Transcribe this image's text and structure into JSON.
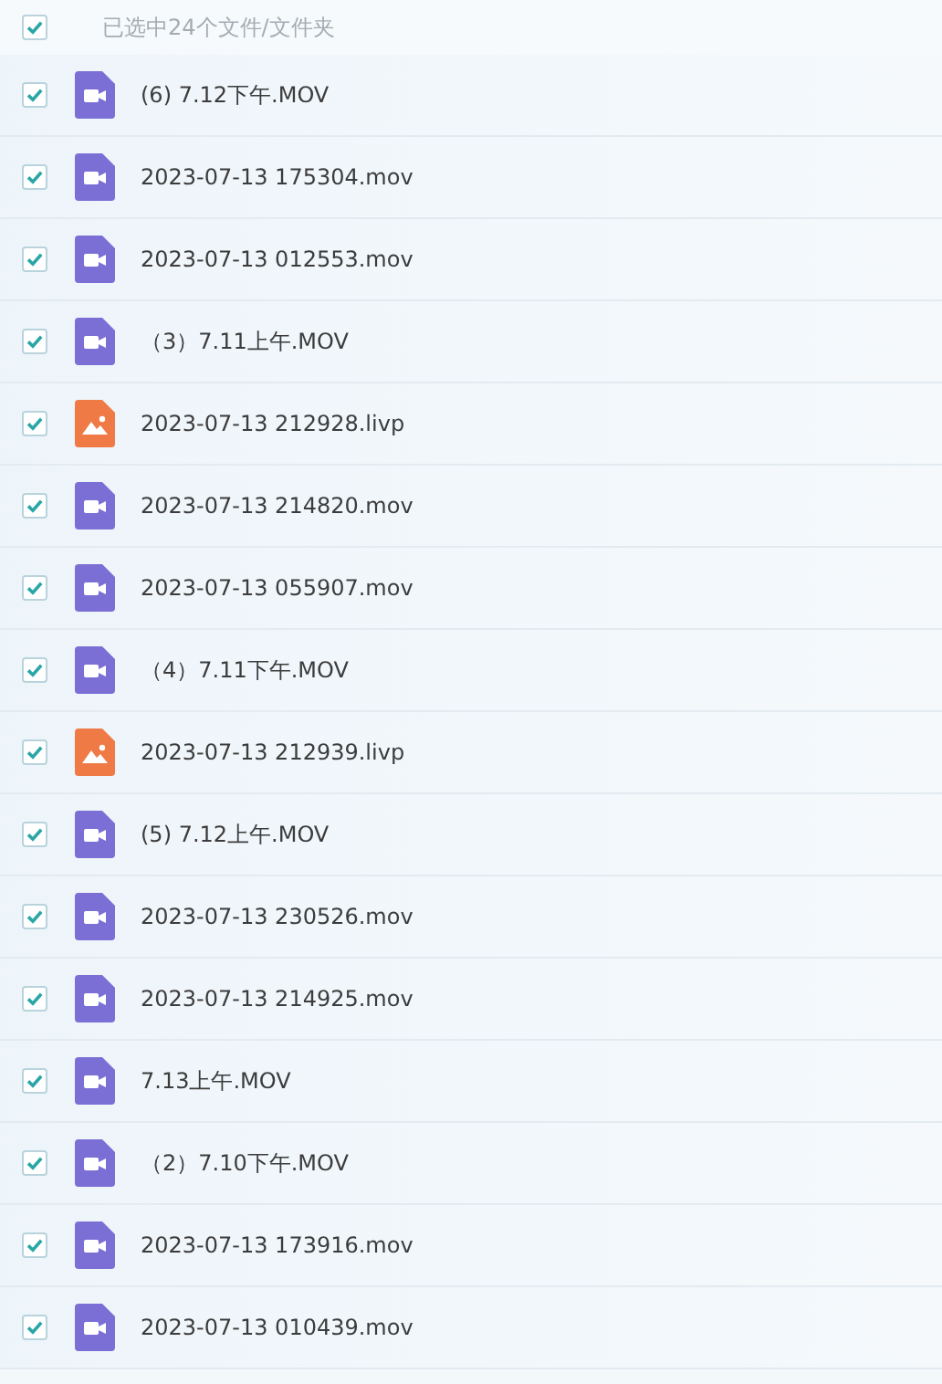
{
  "header": {
    "checked": true,
    "label": "已选中24个文件/文件夹"
  },
  "files": [
    {
      "name": "(6) 7.12下午.MOV",
      "kind": "video",
      "checked": true
    },
    {
      "name": "2023-07-13 175304.mov",
      "kind": "video",
      "checked": true
    },
    {
      "name": "2023-07-13 012553.mov",
      "kind": "video",
      "checked": true
    },
    {
      "name": "（3）7.11上午.MOV",
      "kind": "video",
      "checked": true
    },
    {
      "name": "2023-07-13 212928.livp",
      "kind": "image",
      "checked": true
    },
    {
      "name": "2023-07-13 214820.mov",
      "kind": "video",
      "checked": true
    },
    {
      "name": "2023-07-13 055907.mov",
      "kind": "video",
      "checked": true
    },
    {
      "name": "（4）7.11下午.MOV",
      "kind": "video",
      "checked": true
    },
    {
      "name": "2023-07-13 212939.livp",
      "kind": "image",
      "checked": true
    },
    {
      "name": "(5) 7.12上午.MOV",
      "kind": "video",
      "checked": true
    },
    {
      "name": "2023-07-13 230526.mov",
      "kind": "video",
      "checked": true
    },
    {
      "name": "2023-07-13 214925.mov",
      "kind": "video",
      "checked": true
    },
    {
      "name": "7.13上午.MOV",
      "kind": "video",
      "checked": true
    },
    {
      "name": "（2）7.10下午.MOV",
      "kind": "video",
      "checked": true
    },
    {
      "name": "2023-07-13 173916.mov",
      "kind": "video",
      "checked": true
    },
    {
      "name": "2023-07-13 010439.mov",
      "kind": "video",
      "checked": true
    }
  ]
}
